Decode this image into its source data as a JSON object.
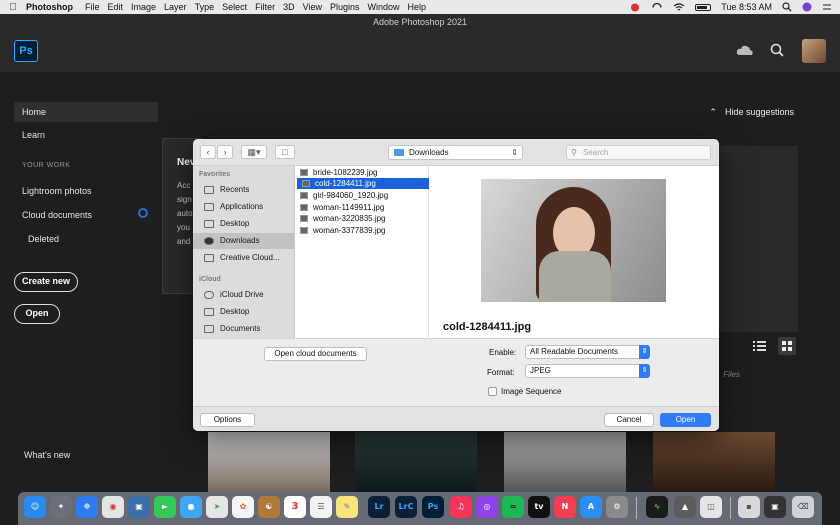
{
  "menubar": {
    "app": "Photoshop",
    "items": [
      "File",
      "Edit",
      "Image",
      "Layer",
      "Type",
      "Select",
      "Filter",
      "3D",
      "View",
      "Plugins",
      "Window",
      "Help"
    ],
    "clock": "Tue 8:53 AM"
  },
  "window": {
    "title": "Adobe Photoshop 2021"
  },
  "ps": {
    "logo": "Ps"
  },
  "sidebar": {
    "home": "Home",
    "learn": "Learn",
    "section_your_work": "YOUR WORK",
    "lightroom": "Lightroom photos",
    "cloud_docs": "Cloud documents",
    "deleted": "Deleted",
    "create_new": "Create new",
    "open": "Open",
    "whats_new": "What's new"
  },
  "main": {
    "hide_suggestions": "Hide suggestions",
    "new_card_title": "Nev",
    "new_card_lines": [
      "Acc",
      "sign",
      "auto",
      "you",
      "and"
    ],
    "files_label": "Files"
  },
  "dialog": {
    "location": "Downloads",
    "search_placeholder": "Search",
    "favorites_head": "Favorites",
    "favorites": [
      "Recents",
      "Applications",
      "Desktop",
      "Downloads",
      "Creative Cloud..."
    ],
    "icloud_head": "iCloud",
    "icloud": [
      "iCloud Drive",
      "Desktop",
      "Documents"
    ],
    "files": [
      "bride-1082239.jpg",
      "cold-1284411.jpg",
      "girl-984060_1920.jpg",
      "woman-1149911.jpg",
      "woman-3220835.jpg",
      "woman-3377839.jpg"
    ],
    "selected_file": "cold-1284411.jpg",
    "open_cloud_docs": "Open cloud documents",
    "enable_label": "Enable:",
    "enable_value": "All Readable Documents",
    "format_label": "Format:",
    "format_value": "JPEG",
    "image_sequence": "Image Sequence",
    "options": "Options",
    "cancel": "Cancel",
    "open": "Open"
  },
  "dock": {
    "lr": "Lr",
    "lrc": "LrC",
    "ps": "Ps"
  },
  "colors": {
    "accent_blue": "#2f7cf6",
    "ps_blue": "#31a8ff",
    "selection_blue": "#1a62d9"
  }
}
